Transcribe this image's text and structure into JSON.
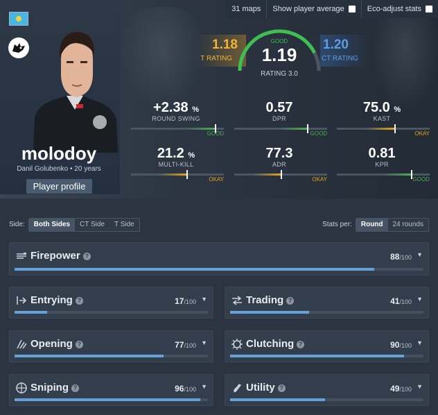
{
  "header": {
    "maps_count": "31 maps",
    "show_player_average": "Show player average",
    "eco_adjust": "Eco-adjust stats"
  },
  "player": {
    "nickname": "molodoy",
    "subtitle": "Danil Golubenko • 20 years",
    "profile_button": "Player profile",
    "flag": "kazakhstan-flag",
    "team_logo": "furia-logo-icon"
  },
  "rating": {
    "t_value": "1.18",
    "t_label": "T RATING",
    "main_value": "1.19",
    "main_label": "RATING 3.0",
    "main_tag": "GOOD",
    "ct_value": "1.20",
    "ct_label": "CT RATING",
    "gauge_level": 0.85
  },
  "stats": [
    {
      "value": "+2.38",
      "unit": "%",
      "label": "ROUND SWING",
      "tag": "GOOD",
      "level": 0.9,
      "color": "#4caf50"
    },
    {
      "value": "0.57",
      "unit": "",
      "label": "DPR",
      "tag": "GOOD",
      "level": 0.78,
      "color": "#4caf50"
    },
    {
      "value": "75.0",
      "unit": "%",
      "label": "KAST",
      "tag": "OKAY",
      "level": 0.62,
      "color": "#e8a317"
    },
    {
      "value": "21.2",
      "unit": "%",
      "label": "MULTI-KILL",
      "tag": "OKAY",
      "level": 0.6,
      "color": "#e8a317"
    },
    {
      "value": "77.3",
      "unit": "",
      "label": "ADR",
      "tag": "OKAY",
      "level": 0.5,
      "color": "#e8a317"
    },
    {
      "value": "0.81",
      "unit": "",
      "label": "KPR",
      "tag": "GOOD",
      "level": 0.8,
      "color": "#4caf50"
    }
  ],
  "filters": {
    "side_label": "Side:",
    "side_options": [
      "Both Sides",
      "CT Side",
      "T Side"
    ],
    "stats_per_label": "Stats per:",
    "per_options": [
      "Round",
      "24 rounds"
    ]
  },
  "categories": [
    {
      "name": "Firepower",
      "score": "88",
      "max": "/100",
      "level": 0.88,
      "icon": "firepower-icon"
    },
    {
      "name": "Entrying",
      "score": "17",
      "max": "/100",
      "level": 0.17,
      "icon": "entrying-icon"
    },
    {
      "name": "Trading",
      "score": "41",
      "max": "/100",
      "level": 0.41,
      "icon": "trading-icon"
    },
    {
      "name": "Opening",
      "score": "77",
      "max": "/100",
      "level": 0.77,
      "icon": "opening-icon"
    },
    {
      "name": "Clutching",
      "score": "90",
      "max": "/100",
      "level": 0.9,
      "icon": "clutching-icon"
    },
    {
      "name": "Sniping",
      "score": "96",
      "max": "/100",
      "level": 0.96,
      "icon": "sniping-icon"
    },
    {
      "name": "Utility",
      "score": "49",
      "max": "/100",
      "level": 0.49,
      "icon": "utility-icon"
    }
  ]
}
